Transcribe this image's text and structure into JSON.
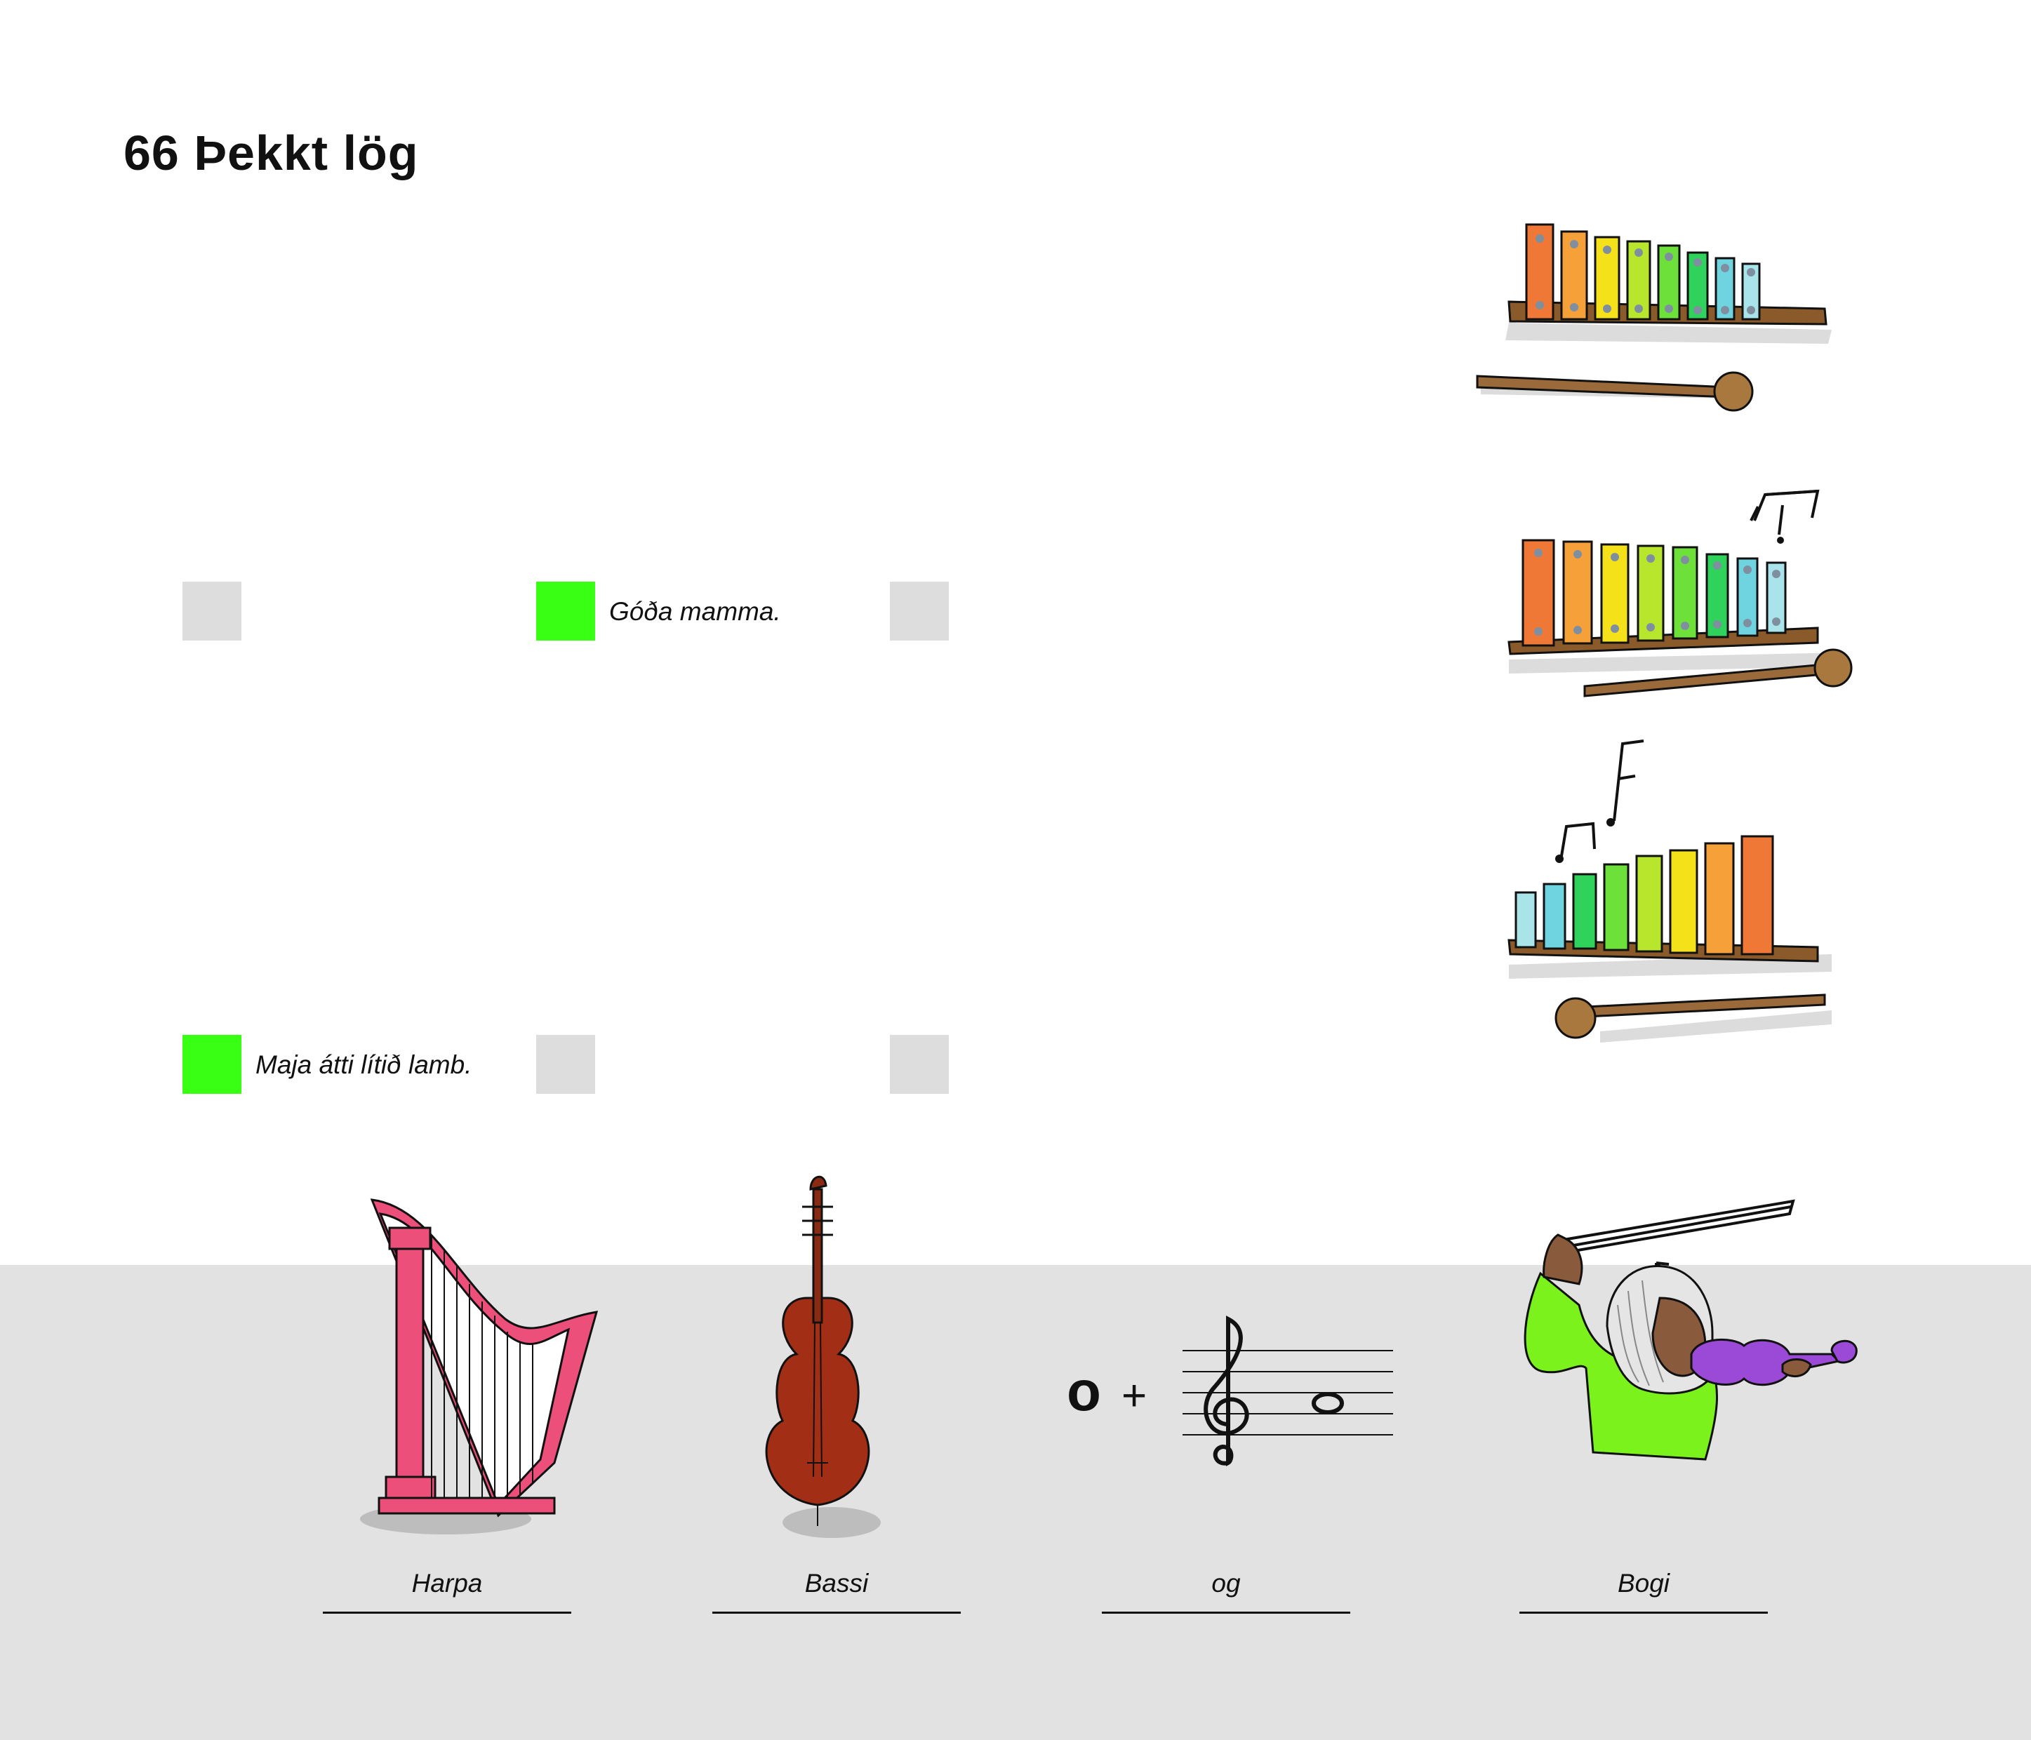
{
  "page": {
    "number": "66",
    "title": "Þekkt lög"
  },
  "colors": {
    "selected": "#39ff14",
    "unselected": "#dddddd",
    "band": "#e2e2e2"
  },
  "options_row1": [
    {
      "checked": false,
      "label": ""
    },
    {
      "checked": true,
      "label": "Góða mamma."
    },
    {
      "checked": false,
      "label": ""
    }
  ],
  "options_row2": [
    {
      "checked": true,
      "label": "Maja átti lítið lamb."
    },
    {
      "checked": false,
      "label": ""
    },
    {
      "checked": false,
      "label": ""
    }
  ],
  "pictures": {
    "xylophones": [
      "xylophone-icon",
      "xylophone-icon",
      "xylophone-icon"
    ],
    "instruments": [
      "harp-icon",
      "cello-icon",
      "whole-note-puzzle-icon",
      "violinist-icon"
    ],
    "puzzle": {
      "letter": "o",
      "operator": "+"
    }
  },
  "answers": [
    "Harpa",
    "Bassi",
    "og",
    "Bogi"
  ]
}
